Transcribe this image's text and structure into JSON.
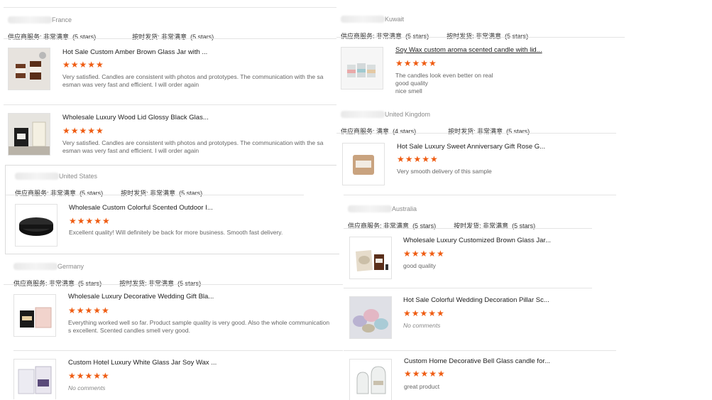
{
  "rating_labels": {
    "service": "供应商服务:",
    "shipping": "按时发货:"
  },
  "reviews": [
    {
      "country": "France",
      "service_rating": "非常满意",
      "service_stars": "(5 stars)",
      "shipping_rating": "非常满意",
      "shipping_stars": "(5 stars)",
      "products": [
        {
          "title": "Hot Sale Custom Amber Brown Glass Jar with ...",
          "stars": 5,
          "comment": "Very satisfied. Candles are consistent with photos and prototypes. The communication with the sa\nesman was very fast and efficient. I will order again"
        },
        {
          "title": "Wholesale Luxury Wood Lid Glossy Black Glas...",
          "stars": 5,
          "comment": "Very satisfied. Candles are consistent with photos and prototypes. The communication with the sa\nesman was very fast and efficient. I will order again"
        }
      ]
    },
    {
      "country": "United States",
      "service_rating": "非常满意",
      "service_stars": "(5 stars)",
      "shipping_rating": "非常满意",
      "shipping_stars": "(5 stars)",
      "products": [
        {
          "title": "Wholesale Custom Colorful Scented Outdoor I...",
          "stars": 5,
          "comment": "Excellent quality! Will definitely be back for more business. Smooth fast delivery."
        }
      ]
    },
    {
      "country": "Germany",
      "service_rating": "非常满意",
      "service_stars": "(5 stars)",
      "shipping_rating": "非常满意",
      "shipping_stars": "(5 stars)",
      "products": [
        {
          "title": "Wholesale Luxury Decorative Wedding Gift Bla...",
          "stars": 5,
          "comment": "Everything worked well so far. Product sample quality is very good. Also the whole communication\ns excellent. Scented candles smell very good."
        },
        {
          "title": "Custom Hotel Luxury White Glass Jar Soy Wax ...",
          "stars": 5,
          "comment": "No comments"
        }
      ]
    },
    {
      "country": "Kuwait",
      "service_rating": "非常满意",
      "service_stars": "(5 stars)",
      "shipping_rating": "非常满意",
      "shipping_stars": "(5 stars)",
      "products": [
        {
          "title": "Soy Wax custom aroma scented candle with lid...",
          "stars": 5,
          "comment": "The candles look even better on real\ngood quality\nnice smell"
        }
      ]
    },
    {
      "country": "United Kingdom",
      "service_rating": "满意",
      "service_stars": "(4 stars)",
      "shipping_rating": "非常满意",
      "shipping_stars": "(5 stars)",
      "products": [
        {
          "title": "Hot Sale Luxury Sweet Anniversary Gift Rose G...",
          "stars": 5,
          "comment": "Very smooth delivery of this sample"
        }
      ]
    },
    {
      "country": "Australia",
      "service_rating": "非常满意",
      "service_stars": "(5 stars)",
      "shipping_rating": "非常满意",
      "shipping_stars": "(5 stars)",
      "products": [
        {
          "title": "Wholesale Luxury Customized Brown Glass Jar...",
          "stars": 5,
          "comment": "good quality"
        },
        {
          "title": "Hot Sale Colorful Wedding Decoration Pillar Sc...",
          "stars": 5,
          "comment": "No comments"
        },
        {
          "title": "Custom Home Decorative Bell Glass candle for...",
          "stars": 5,
          "comment": "great product"
        }
      ]
    }
  ],
  "colors": {
    "star": "#ef5c12",
    "text": "#333333",
    "muted": "#8a8a8a",
    "divider": "#e4e4e4"
  }
}
